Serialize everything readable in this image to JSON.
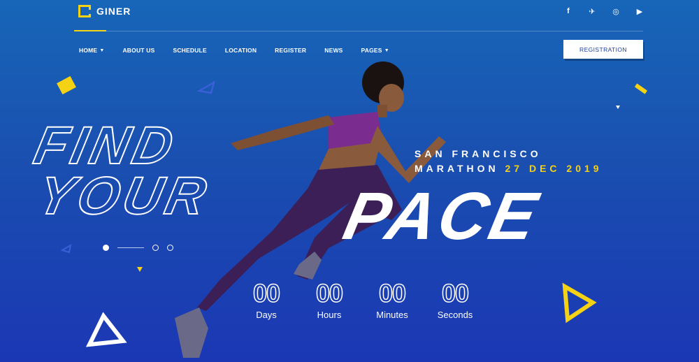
{
  "brand": {
    "name": "GINER"
  },
  "social": [
    {
      "icon": "facebook-icon",
      "glyph": "f"
    },
    {
      "icon": "twitter-icon",
      "glyph": "🐦"
    },
    {
      "icon": "instagram-icon",
      "glyph": "◎"
    },
    {
      "icon": "youtube-icon",
      "glyph": "▶"
    }
  ],
  "nav": {
    "items": [
      {
        "label": "HOME",
        "has_dropdown": true
      },
      {
        "label": "ABOUT US",
        "has_dropdown": false
      },
      {
        "label": "SCHEDULE",
        "has_dropdown": false
      },
      {
        "label": "LOCATION",
        "has_dropdown": false
      },
      {
        "label": "REGISTER",
        "has_dropdown": false
      },
      {
        "label": "NEWS",
        "has_dropdown": false
      },
      {
        "label": "PAGES",
        "has_dropdown": true
      }
    ],
    "cta_label": "REGISTRATION"
  },
  "hero": {
    "headline_outline": [
      "FIND",
      "YOUR"
    ],
    "headline_solid": "PACE",
    "event_line1": "SAN FRANCISCO",
    "event_line2_prefix": "MARATHON",
    "event_date": "27 DEC 2019"
  },
  "countdown": [
    {
      "value": "00",
      "label": "Days"
    },
    {
      "value": "00",
      "label": "Hours"
    },
    {
      "value": "00",
      "label": "Minutes"
    },
    {
      "value": "00",
      "label": "Seconds"
    }
  ],
  "slider": {
    "slides": 3,
    "active": 0
  },
  "colors": {
    "accent": "#f5d214",
    "bg_top": "#1766b8",
    "bg_bottom": "#1b37b4"
  }
}
